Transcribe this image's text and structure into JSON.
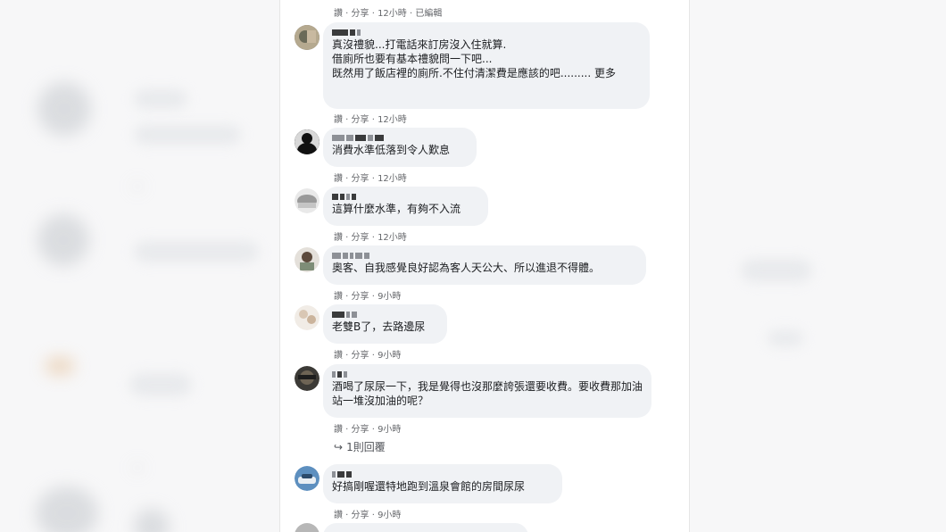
{
  "top_meta": "讚 · 分享 · 12小時 · 已編輯",
  "comments": [
    {
      "text": "真沒禮貌...打電話來訂房沒入住就算.\n借廁所也要有基本禮貌問一下吧...\n既然用了飯店裡的廁所.不住付清潔費是應該的吧......... 更多",
      "meta": "讚 · 分享 · 12小時",
      "avatar": "avatar-1"
    },
    {
      "text": "消費水準低落到令人歎息",
      "meta": "讚 · 分享 · 12小時",
      "avatar": "avatar-2"
    },
    {
      "text": "這算什麼水準，有夠不入流",
      "meta": "讚 · 分享 · 12小時",
      "avatar": "avatar-3"
    },
    {
      "text": "奧客、自我感覺良好認為客人天公大、所以進退不得體。",
      "meta": "讚 · 分享 · 9小時",
      "avatar": "avatar-4"
    },
    {
      "text": "老雙B了，去路邊尿",
      "meta": "讚 · 分享 · 9小時",
      "avatar": "avatar-5"
    },
    {
      "text": "酒喝了尿尿一下，我是覺得也沒那麼誇張還要收費。要收費那加油站一堆沒加油的呢？",
      "meta": "讚 · 分享 · 9小時",
      "avatar": "avatar-6"
    },
    {
      "text": "好搞剛喔還特地跑到溫泉會館的房間尿尿",
      "meta": "讚 · 分享 · 9小時",
      "avatar": "avatar-7"
    }
  ],
  "reply_link": "1則回覆",
  "colors": {
    "bubble": "#f0f2f5",
    "meta": "#65676b",
    "text": "#1c1e21"
  }
}
